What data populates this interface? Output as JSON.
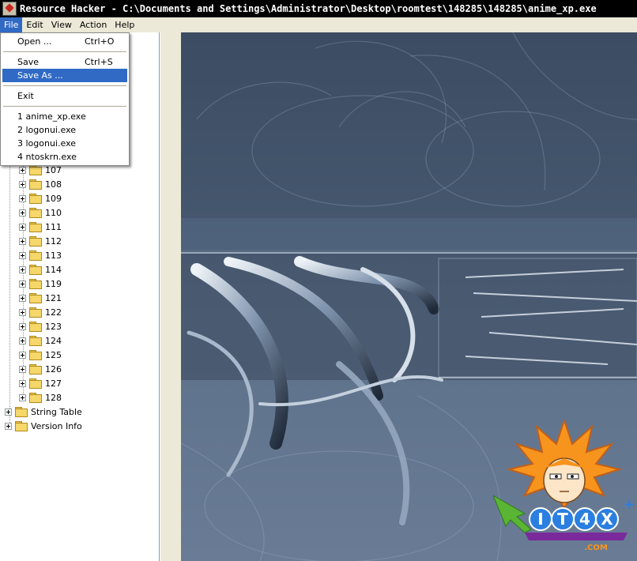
{
  "window": {
    "title": "Resource Hacker  - C:\\Documents and Settings\\Administrator\\Desktop\\roomtest\\148285\\148285\\anime_xp.exe"
  },
  "menubar": {
    "items": [
      {
        "label": "File",
        "open": true
      },
      {
        "label": "Edit"
      },
      {
        "label": "View"
      },
      {
        "label": "Action"
      },
      {
        "label": "Help"
      }
    ]
  },
  "file_menu": {
    "open_label": "Open ...",
    "open_shortcut": "Ctrl+O",
    "save_label": "Save",
    "save_shortcut": "Ctrl+S",
    "save_as_label": "Save As ...",
    "exit_label": "Exit",
    "recent": [
      "1  anime_xp.exe",
      "2  logonui.exe",
      "3  logonui.exe",
      "4  ntoskrn.exe"
    ]
  },
  "tree": {
    "bitmap_children": [
      "107",
      "108",
      "109",
      "110",
      "111",
      "112",
      "113",
      "114",
      "119",
      "121",
      "122",
      "123",
      "124",
      "125",
      "126",
      "127",
      "128"
    ],
    "top_items": [
      "String Table",
      "Version Info"
    ]
  },
  "watermark": {
    "logo_text": "IT4X",
    "domain_text": ".COM",
    "colors": {
      "spark": "#f7941d",
      "green": "#5ab534",
      "blue": "#2a7fe0",
      "purple": "#7a2a9a"
    }
  },
  "theme": {
    "titlebar_bg": "#000000",
    "menu_highlight": "#316ac5",
    "preview_tint": "#566a82"
  }
}
